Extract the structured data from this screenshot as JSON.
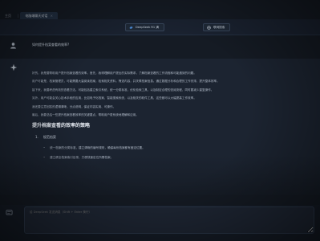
{
  "tabs": [
    {
      "label": "主页",
      "active": false
    },
    {
      "label": "电脑端聊天对话",
      "active": true
    }
  ],
  "tab_separator": "|",
  "tab_close": "×",
  "header": {
    "model_button_1": {
      "icon": "deepseek-whale-icon",
      "label": "DeepSeek R1 满"
    },
    "model_button_2": {
      "icon": "globe-icon",
      "label": "联网搜索"
    }
  },
  "question": {
    "text": "如何提升档案查看的效率?"
  },
  "answer": {
    "paragraphs": [
      "好的，我是要帮助用户提升档案查看的效率。首先，我得理解用户提出的实际需求，了解档案查看的工作流程和可能遇到的问题。",
      "用户可能是，档案管理员，可能需要大量阅读档案，检索相关资料，筛选内容，并关联档案信息。通过数据分析和合理的工作安排，提升整体效率。",
      "接下来，我要考虑有效的查看方法。可能包括建立索引系统，统一分类标准，优化检索工具，以及制定合理的查阅流程，同时要减少重复操作。",
      "另外，用户可能会关心技术手段的应用，比如电子化档案、智能搜索系统，以及相关的软件工具，这些都可以大幅提高工作效率。",
      "我还要注意回答的逻辑清晰，分点说明，保证内容实用、可操作。",
      "最后，我要总结一些提升档案查看效率的关键要点，帮助用户更系统地理解和应用。"
    ],
    "heading": "提升档案查看的效率的策略",
    "list": [
      {
        "num": "1.",
        "title": "规范档案",
        "bullets": [
          "统一档案的分类标准，建立清晰的编号规则，确保每份档案都有固定位置。",
          "建立健全档案索引目录，方便快速定位所需档案。"
        ]
      }
    ]
  },
  "input": {
    "placeholder": "给 DeepSeek 发送消息（Shift + Enter 换行）"
  },
  "colors": {
    "background": "#151b24",
    "answer_bg": "#1c2431",
    "accent": "#4a8bd6"
  }
}
